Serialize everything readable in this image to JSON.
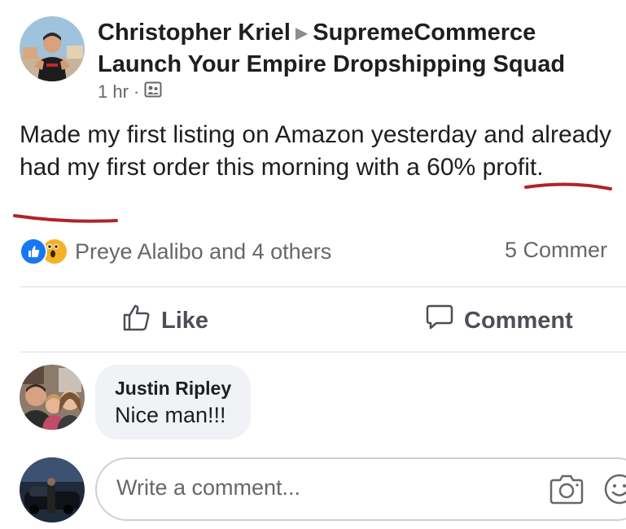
{
  "post": {
    "author": "Christopher Kriel",
    "group": "SupremeCommerce Launch Your Empire Dropshipping Squad",
    "time": "1 hr",
    "separator": "·",
    "audience_icon": "group-audience-icon",
    "text": "Made my first listing on Amazon yesterday and already had my first order this morning with a 60% profit."
  },
  "reactions": {
    "types": [
      "like",
      "wow"
    ],
    "names": "Preye Alalibo and 4 others",
    "comments_count": "5 Commer"
  },
  "actions": {
    "like_label": "Like",
    "comment_label": "Comment"
  },
  "comments": [
    {
      "author": "Justin Ripley",
      "text": "Nice man!!!"
    }
  ],
  "composer": {
    "placeholder": "Write a comment...",
    "icons": [
      "camera-icon",
      "emoji-icon"
    ]
  },
  "colors": {
    "annotation_red": "#b0232a",
    "like_blue": "#1877f2",
    "wow_yellow": "#f7b125"
  }
}
